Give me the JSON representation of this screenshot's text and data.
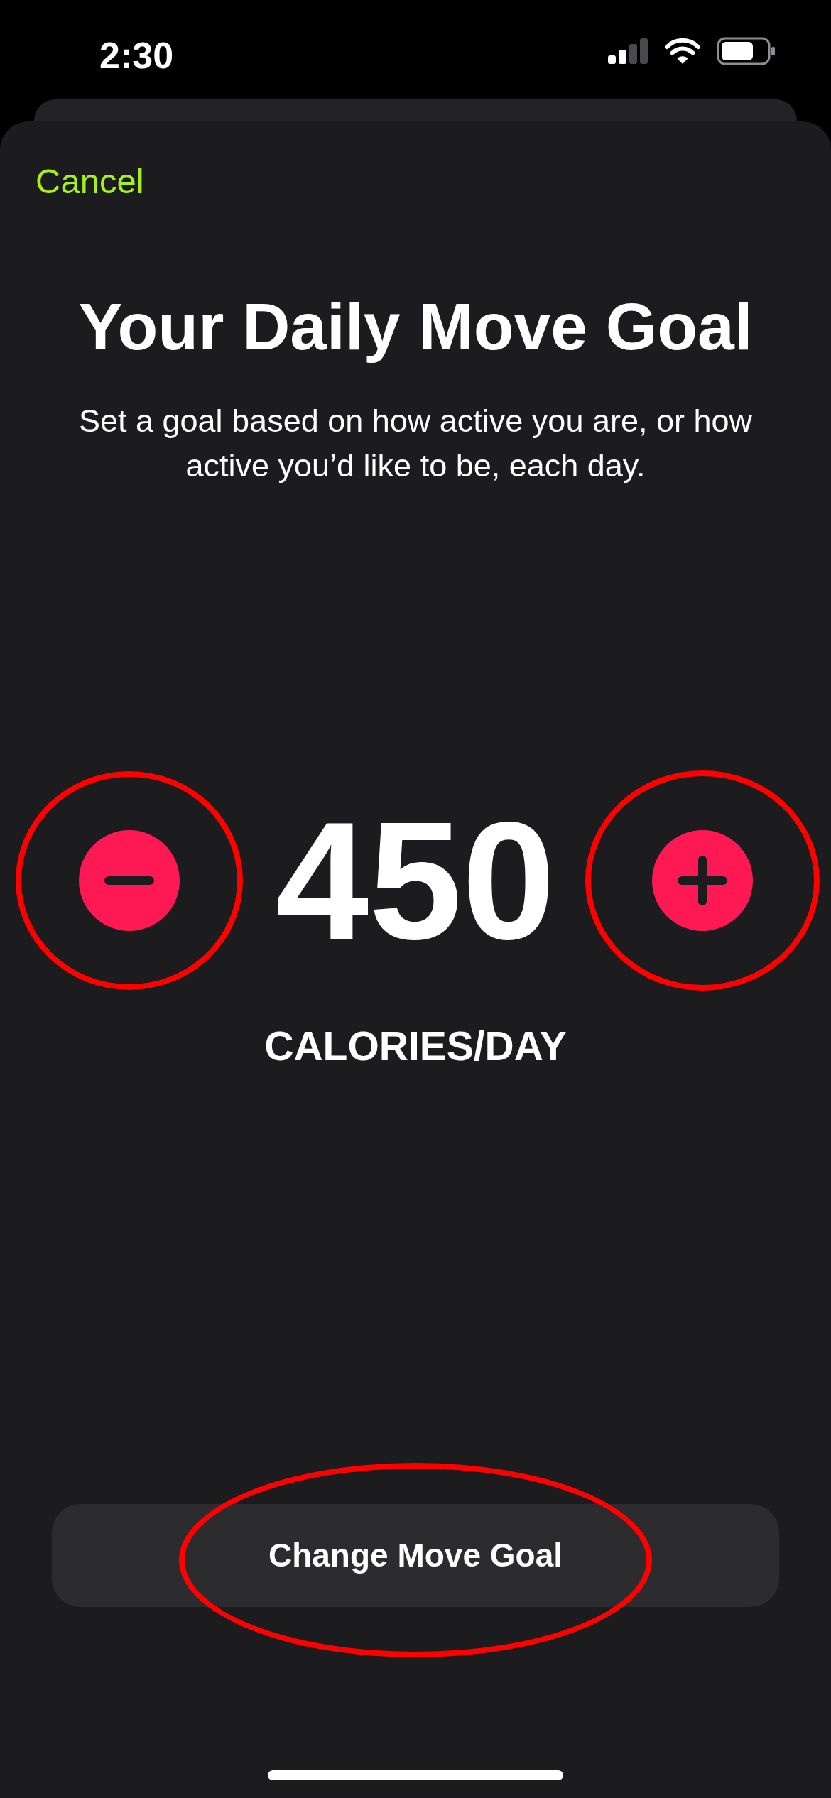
{
  "status_bar": {
    "time": "2:30"
  },
  "header": {
    "cancel": "Cancel"
  },
  "title": "Your Daily Move Goal",
  "subtitle": "Set a goal based on how active you are, or how active you’d like to be, each day.",
  "stepper": {
    "decrease": {
      "circled": true
    },
    "value": "450",
    "increase": {
      "circled": true
    },
    "unit": "CALORIES/DAY"
  },
  "action_button": {
    "label": "Change Move Goal",
    "circled": true
  }
}
